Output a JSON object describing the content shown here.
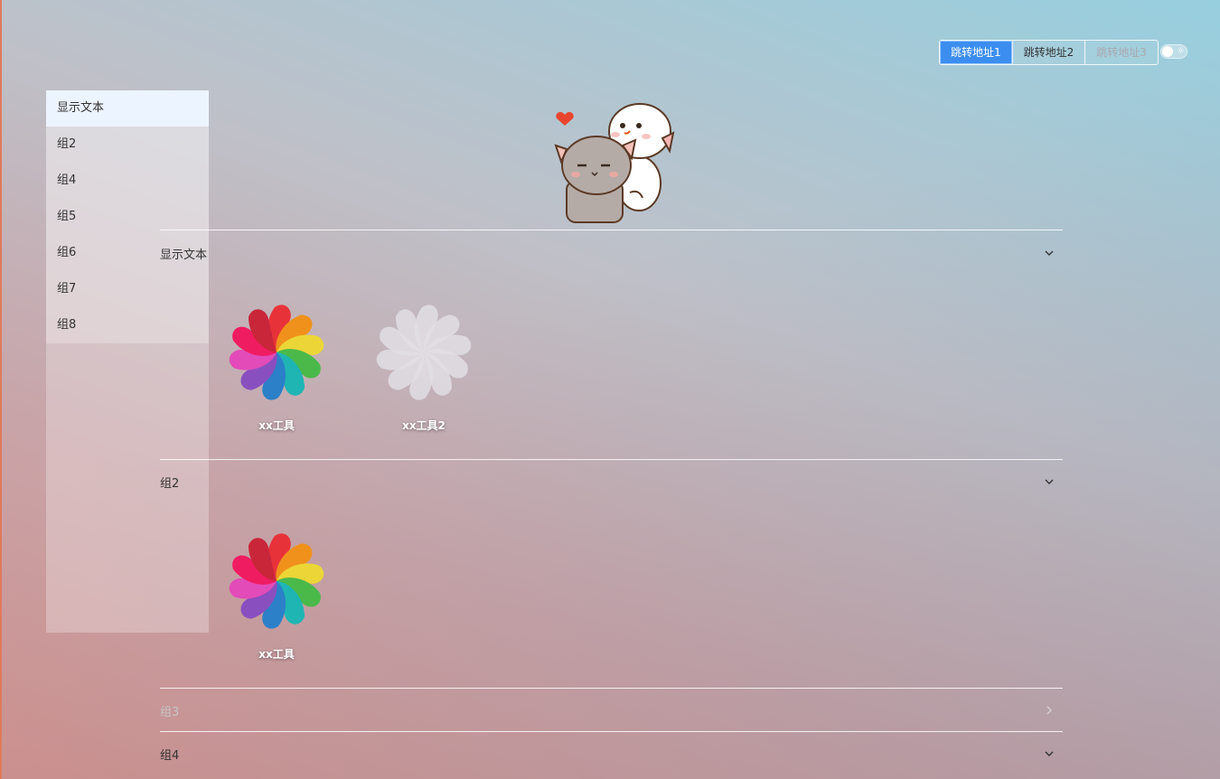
{
  "nav": {
    "buttons": [
      {
        "label": "跳转地址1"
      },
      {
        "label": "跳转地址2"
      },
      {
        "label": "跳转地址3"
      }
    ]
  },
  "sidebar": {
    "items": [
      {
        "label": "显示文本"
      },
      {
        "label": "组2"
      },
      {
        "label": "组4"
      },
      {
        "label": "组5"
      },
      {
        "label": "组6"
      },
      {
        "label": "组7"
      },
      {
        "label": "组8"
      }
    ]
  },
  "sections": [
    {
      "title": "显示文本",
      "expanded": true,
      "tools": [
        {
          "label": "xx工具"
        },
        {
          "label": "xx工具2"
        }
      ]
    },
    {
      "title": "组2",
      "expanded": true,
      "tools": [
        {
          "label": "xx工具"
        }
      ]
    },
    {
      "title": "组3",
      "expanded": false,
      "tools": []
    },
    {
      "title": "组4",
      "expanded": true,
      "tools": []
    }
  ],
  "colors": {
    "accent": "#3b8ef0",
    "petals": [
      "#e8323a",
      "#f0911c",
      "#ecd637",
      "#4bb94a",
      "#1fb5b3",
      "#2b80c8",
      "#8a4fbf",
      "#e24bb8",
      "#f01c62",
      "#c9263a"
    ]
  }
}
